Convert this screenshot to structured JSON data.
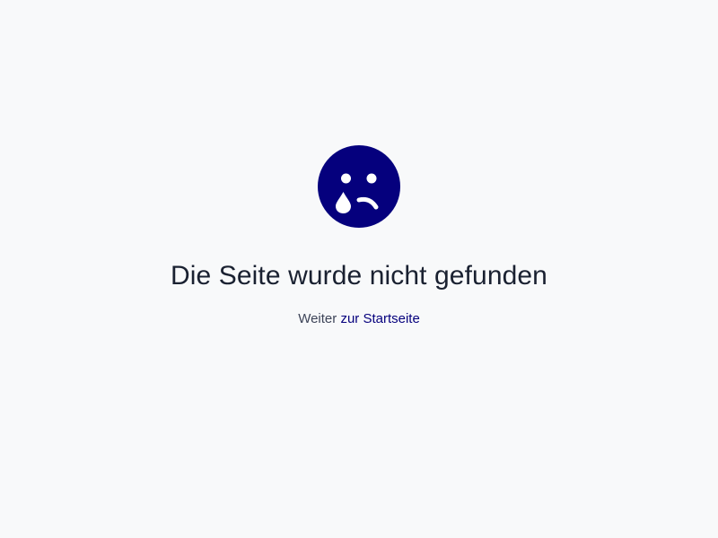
{
  "error_page": {
    "title": "Die Seite wurde nicht gefunden",
    "continue_prefix": "Weiter",
    "homepage_link_label": "zur Startseite",
    "icon": "sad-crying-face-icon"
  },
  "colors": {
    "background": "#f8f9fa",
    "brand": "#05007d",
    "title_text": "#1a2131",
    "body_text": "#3d4458"
  }
}
